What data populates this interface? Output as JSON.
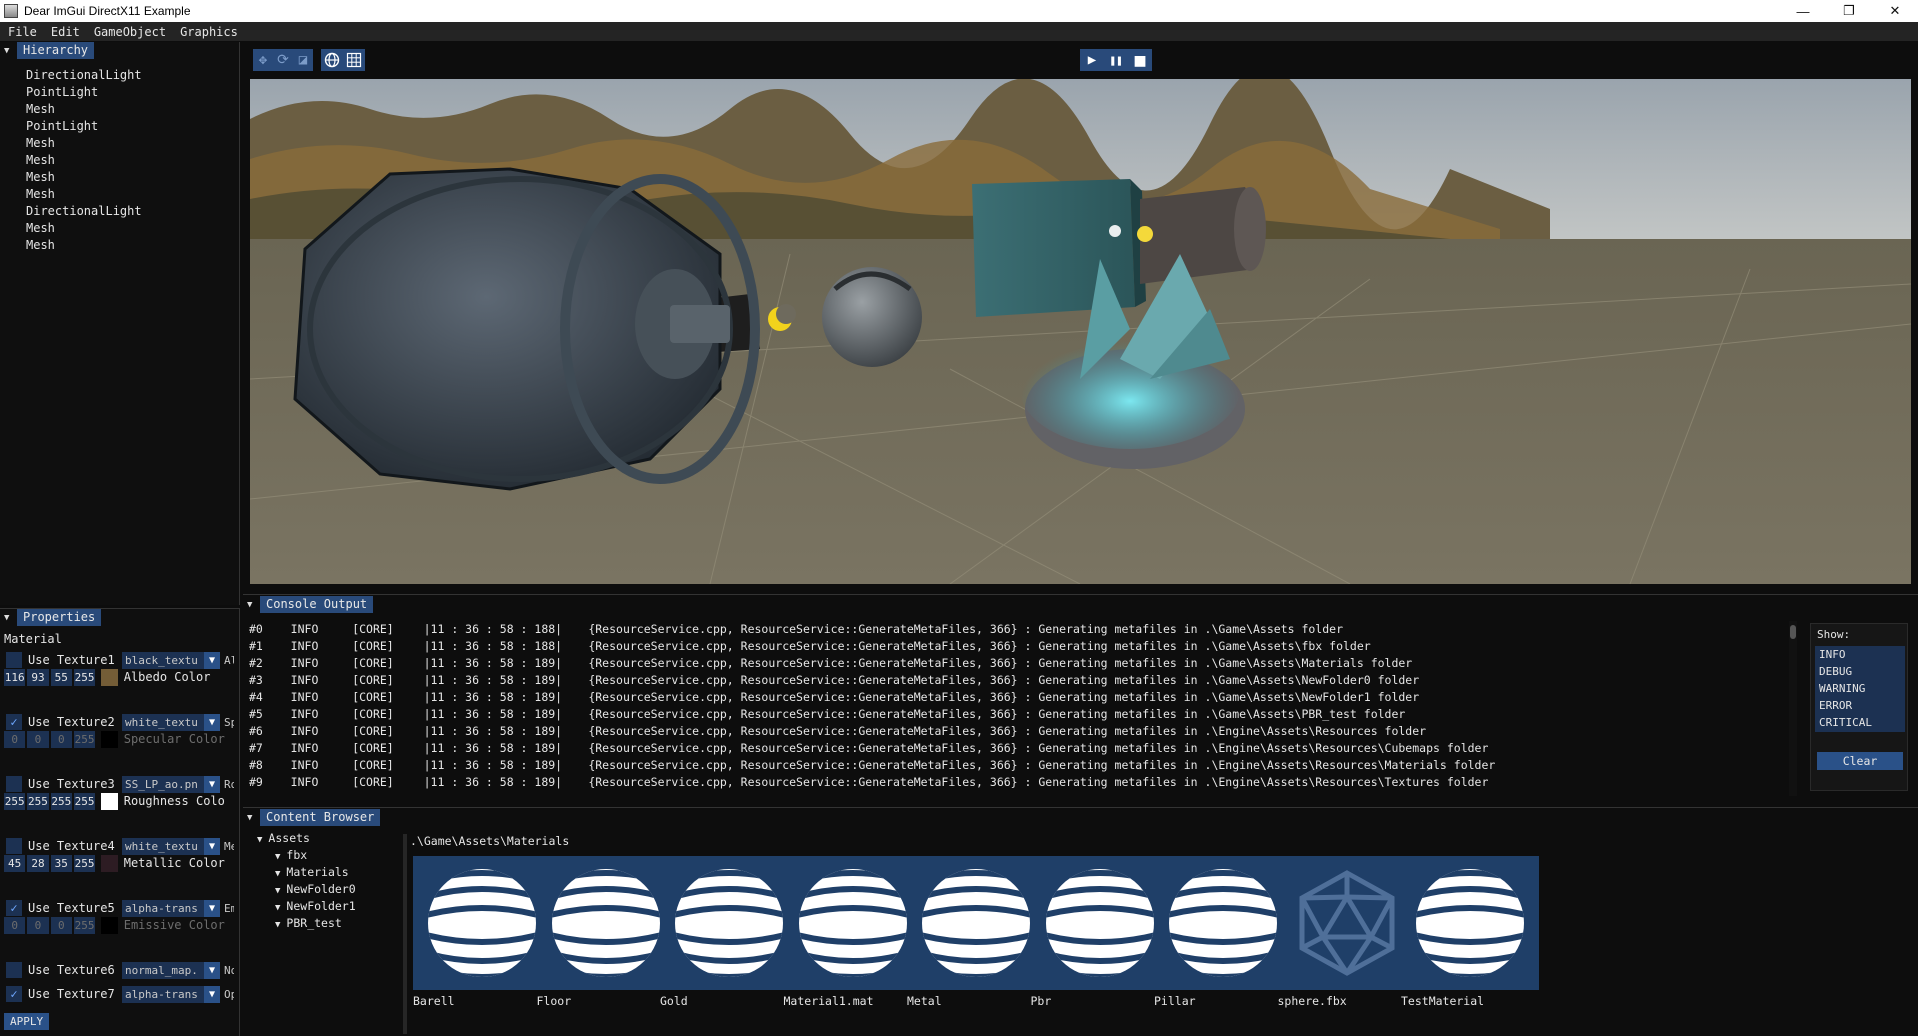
{
  "window": {
    "title": "Dear ImGui DirectX11 Example",
    "min": "—",
    "max": "❐",
    "close": "✕"
  },
  "menu": [
    "File",
    "Edit",
    "GameObject",
    "Graphics"
  ],
  "hierarchy": {
    "title": "Hierarchy",
    "items": [
      "DirectionalLight",
      "PointLight",
      "Mesh",
      "PointLight",
      "Mesh",
      "Mesh",
      "Mesh",
      "Mesh",
      "DirectionalLight",
      "Mesh",
      "Mesh"
    ]
  },
  "properties": {
    "title": "Properties",
    "section": "Material",
    "textures": [
      {
        "label": "Use Texture1",
        "checked": false,
        "value": "black_textu",
        "side": "Al"
      },
      {
        "label": "Use Texture2",
        "checked": true,
        "value": "white_textu",
        "side": "Sp"
      },
      {
        "label": "Use Texture3",
        "checked": false,
        "value": "SS_LP_ao.pn",
        "side": "Ro"
      },
      {
        "label": "Use Texture4",
        "checked": false,
        "value": "white_textu",
        "side": "Me"
      },
      {
        "label": "Use Texture5",
        "checked": true,
        "value": "alpha-trans",
        "side": "Em"
      },
      {
        "label": "Use Texture6",
        "checked": false,
        "value": "normal_map.",
        "side": "No"
      },
      {
        "label": "Use Texture7",
        "checked": true,
        "value": "alpha-trans",
        "side": "Op"
      }
    ],
    "colors": [
      {
        "rgba": [
          "116",
          "93",
          "55",
          "255"
        ],
        "swatch": "#745d37",
        "label": "Albedo Color",
        "dim": false
      },
      {
        "rgba": [
          "0",
          "0",
          "0",
          "255"
        ],
        "swatch": "#000000",
        "label": "Specular Color",
        "dim": true
      },
      {
        "rgba": [
          "255",
          "255",
          "255",
          "255"
        ],
        "swatch": "#ffffff",
        "label": "Roughness Colo",
        "dim": false
      },
      {
        "rgba": [
          "45",
          "28",
          "35",
          "255"
        ],
        "swatch": "#2d1c23",
        "label": "Metallic Color",
        "dim": false
      },
      {
        "rgba": [
          "0",
          "0",
          "0",
          "255"
        ],
        "swatch": "#000000",
        "label": "Emissive Color",
        "dim": true
      }
    ],
    "apply": "APPLY"
  },
  "toolbar": {
    "play": "▶",
    "pause": "❚❚",
    "stop": "■"
  },
  "console": {
    "title": "Console Output",
    "lines": [
      {
        "idx": "#0",
        "level": "INFO",
        "cat": "[CORE]",
        "time": "|11 : 36 : 58 : 188|",
        "msg": "{ResourceService.cpp, ResourceService::GenerateMetaFiles, 366} : Generating metafiles in .\\Game\\Assets folder"
      },
      {
        "idx": "#1",
        "level": "INFO",
        "cat": "[CORE]",
        "time": "|11 : 36 : 58 : 188|",
        "msg": "{ResourceService.cpp, ResourceService::GenerateMetaFiles, 366} : Generating metafiles in .\\Game\\Assets\\fbx folder"
      },
      {
        "idx": "#2",
        "level": "INFO",
        "cat": "[CORE]",
        "time": "|11 : 36 : 58 : 189|",
        "msg": "{ResourceService.cpp, ResourceService::GenerateMetaFiles, 366} : Generating metafiles in .\\Game\\Assets\\Materials folder"
      },
      {
        "idx": "#3",
        "level": "INFO",
        "cat": "[CORE]",
        "time": "|11 : 36 : 58 : 189|",
        "msg": "{ResourceService.cpp, ResourceService::GenerateMetaFiles, 366} : Generating metafiles in .\\Game\\Assets\\NewFolder0 folder"
      },
      {
        "idx": "#4",
        "level": "INFO",
        "cat": "[CORE]",
        "time": "|11 : 36 : 58 : 189|",
        "msg": "{ResourceService.cpp, ResourceService::GenerateMetaFiles, 366} : Generating metafiles in .\\Game\\Assets\\NewFolder1 folder"
      },
      {
        "idx": "#5",
        "level": "INFO",
        "cat": "[CORE]",
        "time": "|11 : 36 : 58 : 189|",
        "msg": "{ResourceService.cpp, ResourceService::GenerateMetaFiles, 366} : Generating metafiles in .\\Game\\Assets\\PBR_test folder"
      },
      {
        "idx": "#6",
        "level": "INFO",
        "cat": "[CORE]",
        "time": "|11 : 36 : 58 : 189|",
        "msg": "{ResourceService.cpp, ResourceService::GenerateMetaFiles, 366} : Generating metafiles in .\\Engine\\Assets\\Resources folder"
      },
      {
        "idx": "#7",
        "level": "INFO",
        "cat": "[CORE]",
        "time": "|11 : 36 : 58 : 189|",
        "msg": "{ResourceService.cpp, ResourceService::GenerateMetaFiles, 366} : Generating metafiles in .\\Engine\\Assets\\Resources\\Cubemaps folder"
      },
      {
        "idx": "#8",
        "level": "INFO",
        "cat": "[CORE]",
        "time": "|11 : 36 : 58 : 189|",
        "msg": "{ResourceService.cpp, ResourceService::GenerateMetaFiles, 366} : Generating metafiles in .\\Engine\\Assets\\Resources\\Materials folder"
      },
      {
        "idx": "#9",
        "level": "INFO",
        "cat": "[CORE]",
        "time": "|11 : 36 : 58 : 189|",
        "msg": "{ResourceService.cpp, ResourceService::GenerateMetaFiles, 366} : Generating metafiles in .\\Engine\\Assets\\Resources\\Textures folder"
      }
    ],
    "show_label": "Show:",
    "filters": [
      "INFO",
      "DEBUG",
      "WARNING",
      "ERROR",
      "CRITICAL"
    ],
    "clear": "Clear"
  },
  "content": {
    "title": "Content Browser",
    "tree": [
      {
        "label": "Assets",
        "depth": 0
      },
      {
        "label": "fbx",
        "depth": 1
      },
      {
        "label": "Materials",
        "depth": 1
      },
      {
        "label": "NewFolder0",
        "depth": 1
      },
      {
        "label": "NewFolder1",
        "depth": 1
      },
      {
        "label": "PBR_test",
        "depth": 1
      }
    ],
    "path": ".\\Game\\Assets\\Materials",
    "assets": [
      {
        "name": "Barell",
        "icon": "material-sphere-icon"
      },
      {
        "name": "Floor",
        "icon": "material-sphere-icon"
      },
      {
        "name": "Gold",
        "icon": "material-sphere-icon"
      },
      {
        "name": "Material1.mat",
        "icon": "material-sphere-icon"
      },
      {
        "name": "Metal",
        "icon": "material-sphere-icon"
      },
      {
        "name": "Pbr",
        "icon": "material-sphere-icon"
      },
      {
        "name": "Pillar",
        "icon": "material-sphere-icon"
      },
      {
        "name": "sphere.fbx",
        "icon": "mesh-icon"
      },
      {
        "name": "TestMaterial",
        "icon": "material-sphere-icon"
      }
    ]
  }
}
